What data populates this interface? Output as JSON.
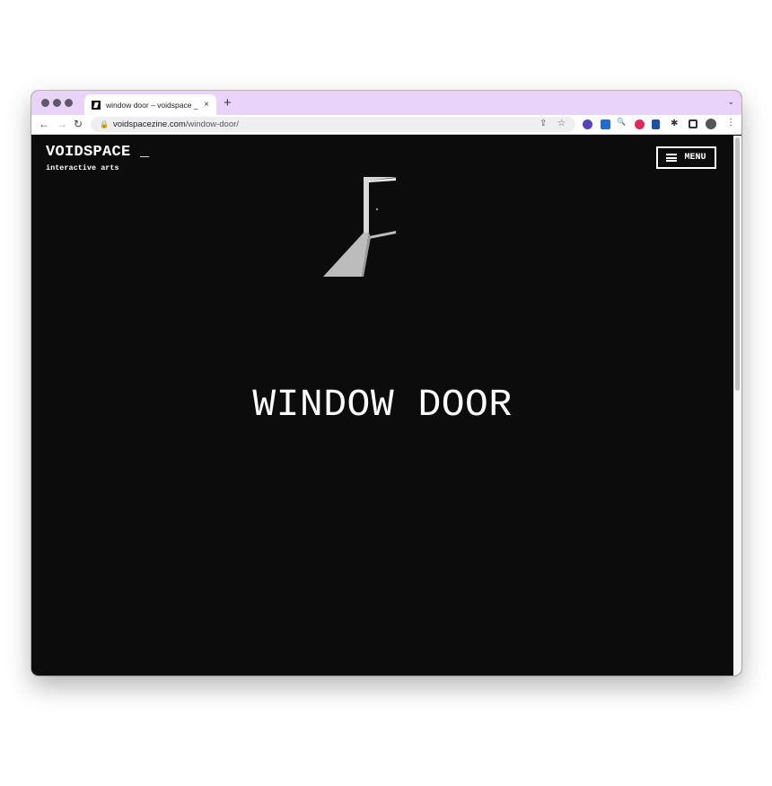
{
  "browser": {
    "tab_title": "window door – voidspace _",
    "tab_close": "×",
    "new_tab": "+",
    "tab_menu": "⌄",
    "nav": {
      "back": "←",
      "forward": "→",
      "reload": "↻"
    },
    "url_host": "voidspacezine.com",
    "url_path": "/window-door/",
    "lock": "🔒",
    "share": "⇪",
    "star": "☆",
    "search": "🔍",
    "puzzle": "✱",
    "more": "⋮",
    "colors": {
      "tabbar": "#ead3fb",
      "accent_ext": "#5a3fc0"
    }
  },
  "site": {
    "logo": "VOIDSPACE _",
    "tagline": "interactive arts",
    "menu_label": "MENU"
  },
  "page": {
    "title": "WINDOW DOOR",
    "art_icon": "open-door-art"
  }
}
